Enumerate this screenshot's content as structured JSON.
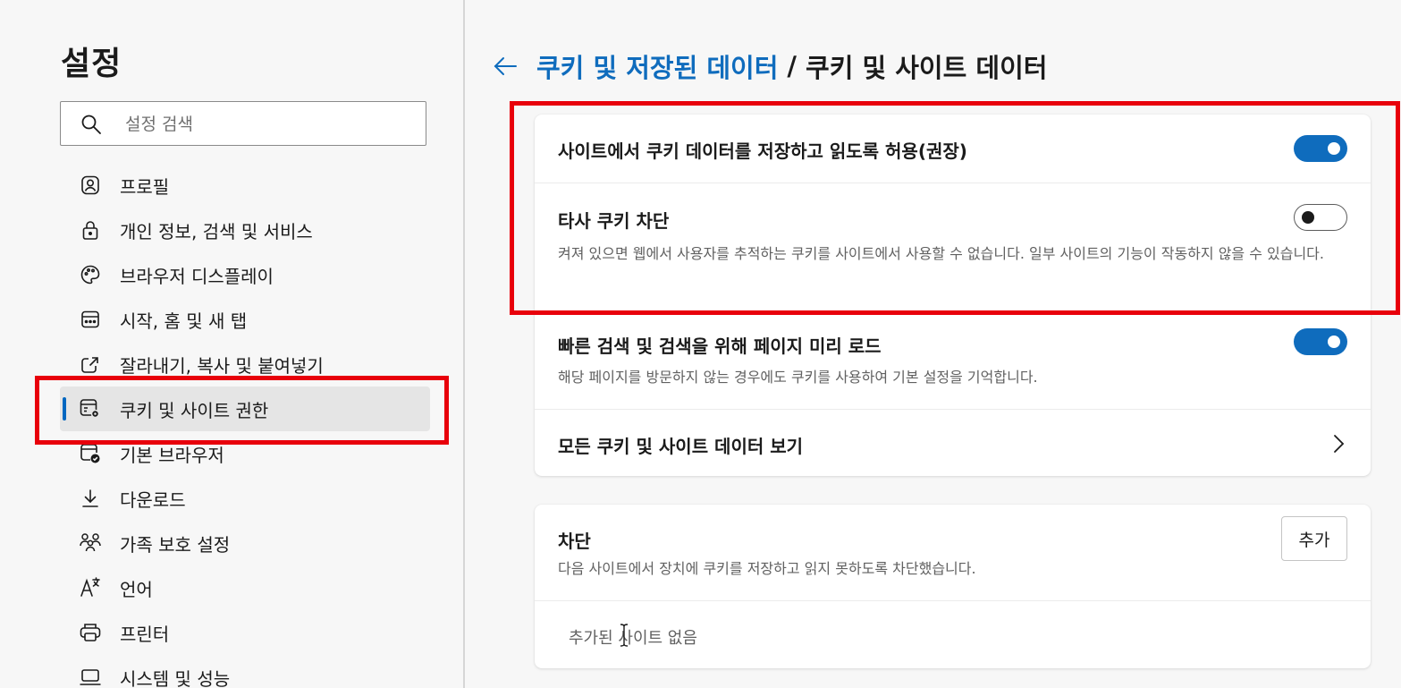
{
  "sidebar": {
    "title": "설정",
    "search": {
      "placeholder": "설정 검색",
      "value": ""
    },
    "items": [
      {
        "label": "프로필",
        "icon": "profile-icon"
      },
      {
        "label": "개인 정보, 검색 및 서비스",
        "icon": "lock-icon"
      },
      {
        "label": "브라우저 디스플레이",
        "icon": "palette-icon"
      },
      {
        "label": "시작, 홈 및 새 탭",
        "icon": "start-home-icon"
      },
      {
        "label": "잘라내기, 복사 및 붙여넣기",
        "icon": "share-icon"
      },
      {
        "label": "쿠키 및 사이트 권한",
        "icon": "cookie-site-permissions-icon",
        "active": true
      },
      {
        "label": "기본 브라우저",
        "icon": "default-browser-icon"
      },
      {
        "label": "다운로드",
        "icon": "download-icon"
      },
      {
        "label": "가족 보호 설정",
        "icon": "family-icon"
      },
      {
        "label": "언어",
        "icon": "language-icon"
      },
      {
        "label": "프린터",
        "icon": "printer-icon"
      },
      {
        "label": "시스템 및 성능",
        "icon": "laptop-icon"
      }
    ]
  },
  "header": {
    "back_icon": "back-arrow-icon",
    "parent": "쿠키 및 저장된 데이터",
    "separator": "/",
    "current": "쿠키 및 사이트 데이터"
  },
  "settings": {
    "allow_cookies": {
      "title": "사이트에서 쿠키 데이터를 저장하고 읽도록 허용(권장)",
      "enabled": true
    },
    "block_third_party": {
      "title": "타사 쿠키 차단",
      "description": "켜져 있으면 웹에서 사용자를 추적하는 쿠키를 사이트에서 사용할 수 없습니다. 일부 사이트의 기능이 작동하지 않을 수 있습니다.",
      "enabled": false
    },
    "preload": {
      "title": "빠른 검색 및 검색을 위해 페이지 미리 로드",
      "description": "해당 페이지를 방문하지 않는 경우에도 쿠키를 사용하여 기본 설정을 기억합니다.",
      "enabled": true
    },
    "see_all": {
      "title": "모든 쿠키 및 사이트 데이터 보기"
    }
  },
  "block": {
    "title": "차단",
    "description": "다음 사이트에서 장치에 쿠키를 저장하고 읽지 못하도록 차단했습니다.",
    "add_label": "추가",
    "empty": "추가된 사이트 없음"
  },
  "colors": {
    "accent": "#0f6cbd",
    "highlight": "#e8000b",
    "sidebar_bg": "#f7f7f7",
    "card_bg": "#ffffff"
  }
}
